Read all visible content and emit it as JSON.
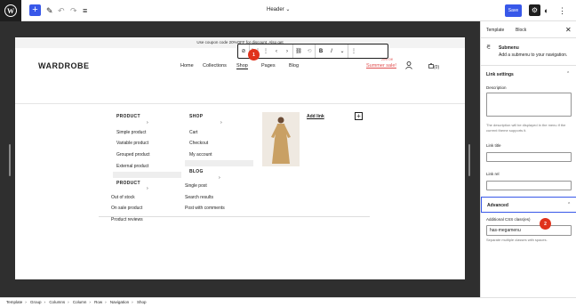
{
  "topbar": {
    "logo": "W",
    "add": "+",
    "edit": "✎",
    "undo": "↶",
    "redo": "↷",
    "list": "≡",
    "doc_title": "Header",
    "doc_chev": "⌄",
    "save": "Save",
    "settings": "⚙",
    "styles": "◐",
    "more": "⋮"
  },
  "site": {
    "promo": "Use coupon code 20%OFF for discount. Also get",
    "logo": "WARDROBE",
    "nav": [
      "Home",
      "Collections",
      "Shop",
      "Pages",
      "Blog"
    ],
    "sale": "Summer sale!",
    "sale_tag": "20% Off",
    "cart_count": "(0)"
  },
  "toolbar": {
    "items": [
      "⊘",
      "⋮⋮",
      "⋮",
      "‹",
      "›",
      "⛓",
      "⟲",
      "B",
      "I",
      "⌄",
      "⋮"
    ]
  },
  "markers": [
    "1",
    "2"
  ],
  "megamenu": {
    "col1": {
      "heading": "PRODUCT",
      "items": [
        "Simple product",
        "Variable product",
        "Grouped product",
        "External product"
      ]
    },
    "col1b": {
      "heading": "PRODUCT",
      "items": [
        "Out of stock",
        "On sale product",
        "Product reviews"
      ]
    },
    "col2": {
      "heading": "SHOP",
      "items": [
        "Cart",
        "Checkout",
        "My account"
      ]
    },
    "col2b": {
      "heading": "BLOG",
      "items": [
        "Single post",
        "Search results",
        "Post with comments"
      ]
    },
    "add_link": "Add link",
    "plus": "+"
  },
  "sidebar": {
    "tabs": [
      "Template",
      "Block"
    ],
    "close": "✕",
    "block_title": "Submenu",
    "block_desc": "Add a submenu to your navigation.",
    "link_settings": "Link settings",
    "description_label": "Description",
    "description_help": "The description will be displayed in the menu if the current theme supports it.",
    "link_title_label": "Link title",
    "link_rel_label": "Link rel",
    "advanced": "Advanced",
    "css_label": "Additional CSS class(es)",
    "css_value": "has-megamenu",
    "css_help": "Separate multiple classes with spaces."
  },
  "breadcrumb": [
    "Template",
    "Group",
    "Columns",
    "Column",
    "Row",
    "Navigation",
    "Shop"
  ]
}
